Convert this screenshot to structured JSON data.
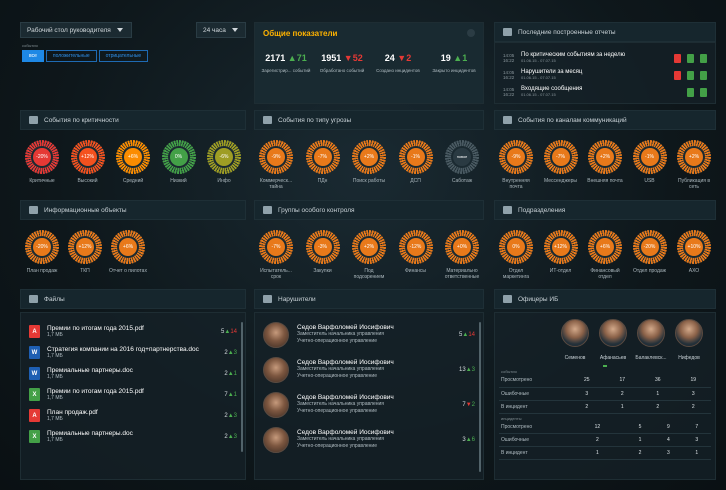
{
  "top": {
    "view_select": "Рабочий стол руководителя",
    "period_select": "24 часа",
    "filter_label": "события",
    "tabs": [
      "все",
      "положительные",
      "отрицательные"
    ]
  },
  "kpi": {
    "title": "Общие показатели",
    "items": [
      {
        "value": "2171",
        "delta": "71",
        "dir": "up",
        "label": "Зарегистрир... событий"
      },
      {
        "value": "1951",
        "delta": "52",
        "dir": "dn",
        "label": "Обработано событий"
      },
      {
        "value": "24",
        "delta": "2",
        "dir": "dn",
        "label": "Создано инцидентов"
      },
      {
        "value": "19",
        "delta": "1",
        "dir": "up",
        "label": "Закрыто инцидентов"
      }
    ]
  },
  "reports": {
    "title": "Последние построенные отчеты",
    "items": [
      {
        "time": "14:05 16:22",
        "name": "По критическим событиям за неделю",
        "sub": "01.06.15 - 07.07.15"
      },
      {
        "time": "14:05 16:22",
        "name": "Нарушители за месяц",
        "sub": "01.06.15 - 07.07.15"
      },
      {
        "time": "14:05 16:22",
        "name": "Входящие сообщения",
        "sub": "01.06.15 - 07.07.15"
      }
    ]
  },
  "crit": {
    "title": "События по критичности",
    "items": [
      {
        "v": "-20%",
        "l": "Критичные",
        "c": "#e53935"
      },
      {
        "v": "+12%",
        "l": "Высокий",
        "c": "#f4511e"
      },
      {
        "v": "+6%",
        "l": "Средний",
        "c": "#fb8c00"
      },
      {
        "v": "0%",
        "l": "Низкий",
        "c": "#43a047"
      },
      {
        "v": "-6%",
        "l": "Инфо",
        "c": "#9e9d24"
      }
    ]
  },
  "threat": {
    "title": "События по типу угрозы",
    "items": [
      {
        "v": "-9%",
        "l": "Коммерческ... тайна"
      },
      {
        "v": "-7%",
        "l": "ПДн"
      },
      {
        "v": "+2%",
        "l": "Поиск работы"
      },
      {
        "v": "-1%",
        "l": "ДСП"
      },
      {
        "v": "новое",
        "l": "Саботаж"
      }
    ]
  },
  "channels": {
    "title": "События по каналам коммуникаций",
    "items": [
      {
        "v": "-9%",
        "l": "Внутренняя почта"
      },
      {
        "v": "-7%",
        "l": "Мессенджеры"
      },
      {
        "v": "+2%",
        "l": "Внешняя почта"
      },
      {
        "v": "-1%",
        "l": "USB"
      },
      {
        "v": "+2%",
        "l": "Публикация в сеть"
      }
    ]
  },
  "info": {
    "title": "Информационные объекты",
    "items": [
      {
        "v": "-20%",
        "l": "План продаж"
      },
      {
        "v": "+12%",
        "l": "ТКП"
      },
      {
        "v": "+6%",
        "l": "Отчет о пилотах"
      }
    ]
  },
  "control": {
    "title": "Группы особого контроля",
    "items": [
      {
        "v": "-7%",
        "l": "Испытатель... срок"
      },
      {
        "v": "-3%",
        "l": "Закупки"
      },
      {
        "v": "+2%",
        "l": "Под подозрением"
      },
      {
        "v": "-12%",
        "l": "Финансы"
      },
      {
        "v": "+0%",
        "l": "Материально ответственные"
      }
    ]
  },
  "units": {
    "title": "Подразделения",
    "items": [
      {
        "v": "0%",
        "l": "Отдел маркетинга"
      },
      {
        "v": "+12%",
        "l": "ИТ-отдел"
      },
      {
        "v": "+6%",
        "l": "Финансовый отдел"
      },
      {
        "v": "-20%",
        "l": "Отдел продаж"
      },
      {
        "v": "+10%",
        "l": "АХО"
      }
    ]
  },
  "files": {
    "title": "Файлы",
    "items": [
      {
        "t": "pdf",
        "n": "Премии по итогам года 2015.pdf",
        "s": "1,7 МБ",
        "a": "5",
        "d": "14",
        "dir": "up"
      },
      {
        "t": "doc",
        "n": "Стратегия компании на 2016 год+партнерства.doc",
        "s": "1,7 МБ",
        "a": "2",
        "d": "3",
        "dir": "up"
      },
      {
        "t": "doc",
        "n": "Премиальные партнеры.doc",
        "s": "1,7 МБ",
        "a": "2",
        "d": "1",
        "dir": "up"
      },
      {
        "t": "xls",
        "n": "Премии по итогам года 2015.pdf",
        "s": "1,7 МБ",
        "a": "7",
        "d": "1",
        "dir": "up"
      },
      {
        "t": "pdf",
        "n": "План продаж.pdf",
        "s": "1,7 МБ",
        "a": "2",
        "d": "3",
        "dir": "up"
      },
      {
        "t": "xls",
        "n": "Премиальные партнеры.doc",
        "s": "1,7 МБ",
        "a": "2",
        "d": "3",
        "dir": "up"
      }
    ]
  },
  "violators": {
    "title": "Нарушители",
    "items": [
      {
        "n": "Седов Варфоломей Иосифович",
        "p": "Заместитель начальника управления",
        "u": "Учетно-операционное управление",
        "a": "5",
        "d": "14",
        "dir": "up"
      },
      {
        "n": "Седов Варфоломей Иосифович",
        "p": "Заместитель начальника управления",
        "u": "Учетно-операционное управление",
        "a": "13",
        "d": "3",
        "dir": "up"
      },
      {
        "n": "Седов Варфоломей Иосифович",
        "p": "Заместитель начальника управления",
        "u": "Учетно-операционное управление",
        "a": "7",
        "d": "2",
        "dir": "dn"
      },
      {
        "n": "Седов Варфоломей Иосифович",
        "p": "Заместитель начальника управления",
        "u": "Учетно-операционное управление",
        "a": "3",
        "d": "6",
        "dir": "up"
      }
    ]
  },
  "officers": {
    "title": "Офицеры ИБ",
    "names": [
      "Семенов",
      "Афанасьев",
      "Балаклевск...",
      "Нифедов"
    ],
    "events_label": "события",
    "incidents_label": "инциденты",
    "events": [
      {
        "l": "Просмотрено",
        "v": [
          "25",
          "17",
          "36",
          "19"
        ]
      },
      {
        "l": "Ошибочные",
        "v": [
          "3",
          "2",
          "1",
          "3"
        ]
      },
      {
        "l": "В инцидент",
        "v": [
          "2",
          "1",
          "2",
          "2"
        ]
      }
    ],
    "incidents": [
      {
        "l": "Просмотрено",
        "v": [
          "12",
          "5",
          "9",
          "7"
        ]
      },
      {
        "l": "Ошибочные",
        "v": [
          "2",
          "1",
          "4",
          "3"
        ]
      },
      {
        "l": "В инцидент",
        "v": [
          "1",
          "2",
          "3",
          "1"
        ]
      }
    ]
  }
}
